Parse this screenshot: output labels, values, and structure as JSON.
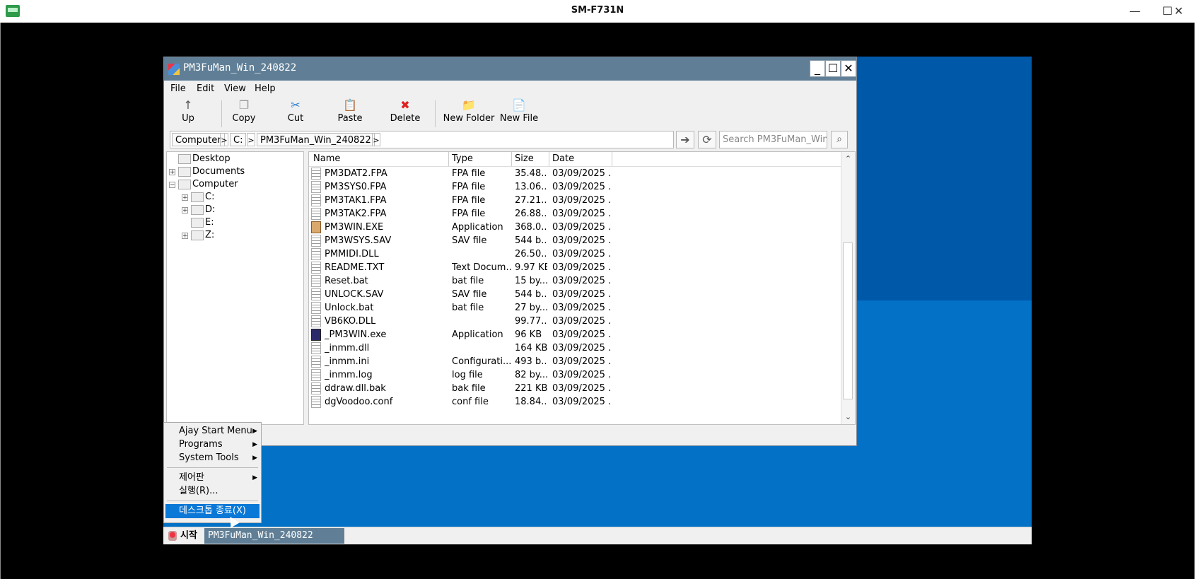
{
  "host": {
    "title": "SM-F731N",
    "minimize": "—",
    "maximize": "☐",
    "close": "✕"
  },
  "window": {
    "title": "PM3FuMan_Win_240822",
    "btn_min": "_",
    "btn_max": "☐",
    "btn_close": "✕"
  },
  "menu": [
    "File",
    "Edit",
    "View",
    "Help"
  ],
  "toolbar": [
    {
      "icon": "arrow-up-icon",
      "glyph": "↑",
      "label": "Up",
      "color": "#555555"
    },
    {
      "icon": "copy-icon",
      "glyph": "❐",
      "label": "Copy",
      "color": "#999999"
    },
    {
      "icon": "scissors-icon",
      "glyph": "✂",
      "label": "Cut",
      "color": "#2f7fd0"
    },
    {
      "icon": "paste-icon",
      "glyph": "📋",
      "label": "Paste",
      "color": "#c89a3a"
    },
    {
      "icon": "delete-icon",
      "glyph": "✖",
      "label": "Delete",
      "color": "#e02020"
    },
    {
      "icon": "new-folder-icon",
      "glyph": "📁",
      "label": "New Folder",
      "color": "#e0b030"
    },
    {
      "icon": "new-file-icon",
      "glyph": "📄",
      "label": "New File",
      "color": "#3a7ad0"
    }
  ],
  "address": {
    "crumbs": [
      "Computer",
      "C:",
      "PM3FuMan_Win_240822"
    ],
    "search_placeholder": "Search PM3FuMan_Win_"
  },
  "tree": [
    {
      "label": "Desktop",
      "icon": "desktop-icon"
    },
    {
      "label": "Documents",
      "icon": "documents-icon",
      "expand": "+"
    },
    {
      "label": "Computer",
      "icon": "computer-icon",
      "expand": "−"
    },
    {
      "label": "C:",
      "icon": "drive-icon",
      "expand": "+"
    },
    {
      "label": "D:",
      "icon": "drive-icon",
      "expand": "+"
    },
    {
      "label": "E:",
      "icon": "drive-icon"
    },
    {
      "label": "Z:",
      "icon": "drive-icon",
      "expand": "+"
    }
  ],
  "columns": [
    "Name",
    "Type",
    "Size",
    "Date"
  ],
  "files": [
    {
      "name": "PM3DAT2.FPA",
      "type": "FPA file",
      "size": "35.48...",
      "date": "03/09/2025 ..."
    },
    {
      "name": "PM3SYS0.FPA",
      "type": "FPA file",
      "size": "13.06...",
      "date": "03/09/2025 ..."
    },
    {
      "name": "PM3TAK1.FPA",
      "type": "FPA file",
      "size": "27.21...",
      "date": "03/09/2025 ..."
    },
    {
      "name": "PM3TAK2.FPA",
      "type": "FPA file",
      "size": "26.88...",
      "date": "03/09/2025 ..."
    },
    {
      "name": "PM3WIN.EXE",
      "type": "Application",
      "size": "368.0...",
      "date": "03/09/2025 ...",
      "kind": "app"
    },
    {
      "name": "PM3WSYS.SAV",
      "type": "SAV file",
      "size": "544 b...",
      "date": "03/09/2025 ..."
    },
    {
      "name": "PMMIDI.DLL",
      "type": "",
      "size": "26.50...",
      "date": "03/09/2025 ..."
    },
    {
      "name": "README.TXT",
      "type": "Text Docum...",
      "size": "9.97 KB",
      "date": "03/09/2025 ..."
    },
    {
      "name": "Reset.bat",
      "type": "bat file",
      "size": "15 by...",
      "date": "03/09/2025 ..."
    },
    {
      "name": "UNLOCK.SAV",
      "type": "SAV file",
      "size": "544 b...",
      "date": "03/09/2025 ..."
    },
    {
      "name": "Unlock.bat",
      "type": "bat file",
      "size": "27 by...",
      "date": "03/09/2025 ..."
    },
    {
      "name": "VB6KO.DLL",
      "type": "",
      "size": "99.77...",
      "date": "03/09/2025 ..."
    },
    {
      "name": "_PM3WIN.exe",
      "type": "Application",
      "size": "96 KB",
      "date": "03/09/2025 ...",
      "kind": "app2"
    },
    {
      "name": "_inmm.dll",
      "type": "",
      "size": "164 KB",
      "date": "03/09/2025 ..."
    },
    {
      "name": "_inmm.ini",
      "type": "Configurati...",
      "size": "493 b...",
      "date": "03/09/2025 ..."
    },
    {
      "name": "_inmm.log",
      "type": "log file",
      "size": "82 by...",
      "date": "03/09/2025 ..."
    },
    {
      "name": "ddraw.dll.bak",
      "type": "bak file",
      "size": "221 KB",
      "date": "03/09/2025 ..."
    },
    {
      "name": "dgVoodoo.conf",
      "type": "conf file",
      "size": "18.84...",
      "date": "03/09/2025 ..."
    }
  ],
  "startmenu": {
    "items": [
      {
        "label": "Ajay Start Menu",
        "arrow": "▶"
      },
      {
        "label": "Programs",
        "arrow": "▶"
      },
      {
        "label": "System Tools",
        "arrow": "▶"
      },
      {
        "label": "제어판",
        "arrow": "▶"
      },
      {
        "label": "실행(R)...",
        "arrow": ""
      },
      {
        "label": "데스크톱 종료(X)",
        "arrow": "",
        "selected": true
      }
    ]
  },
  "taskbar": {
    "start_label": "시작",
    "task_label": "PM3FuMan_Win_240822"
  },
  "colors": {
    "desktop": "#0271c6",
    "titlebar": "#607f96",
    "selection": "#0a78d7"
  }
}
